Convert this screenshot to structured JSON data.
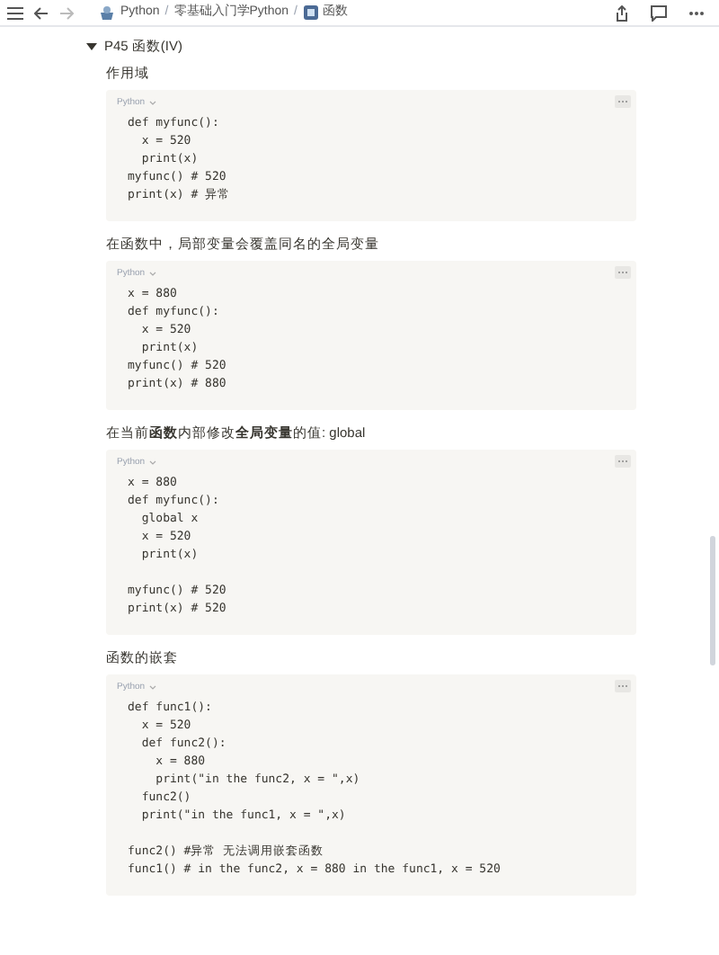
{
  "breadcrumbs": [
    {
      "label": "Python"
    },
    {
      "separator": "/",
      "label": "零基础入门学Python"
    },
    {
      "separator": "/",
      "label": "函数"
    }
  ],
  "toggle": {
    "title": "P45 函数(IV)",
    "expanded": true
  },
  "sections": [
    {
      "heading": "作用域",
      "language": "Python",
      "groups": [
        [
          "def myfunc():",
          "  x = 520",
          "  print(x)",
          "myfunc() # 520",
          "print(x) # 异常"
        ]
      ]
    },
    {
      "heading": "在函数中，局部变量会覆盖同名的全局变量",
      "language": "Python",
      "groups": [
        [
          "x = 880",
          "def myfunc():",
          "  x = 520",
          "  print(x)",
          "myfunc() # 520",
          "print(x) # 880"
        ]
      ]
    },
    {
      "heading": "在当前**函数**内部修改**全局变量**的值: global",
      "language": "Python",
      "groups": [
        [
          "x = 880",
          "def myfunc():",
          "  global x",
          "  x = 520",
          "  print(x)"
        ],
        [
          "myfunc() # 520",
          "print(x) # 520"
        ]
      ]
    },
    {
      "heading": "函数的嵌套",
      "language": "Python",
      "groups": [
        [
          "def func1():",
          "  x = 520",
          "  def func2():",
          "    x = 880",
          "    print(\"in the func2, x = \",x)",
          "  func2()",
          "  print(\"in the func1, x = \",x)"
        ],
        [
          "func2() #异常 无法调用嵌套函数",
          "func1() # in the func2, x = 880 in the func1, x = 520"
        ]
      ]
    }
  ]
}
